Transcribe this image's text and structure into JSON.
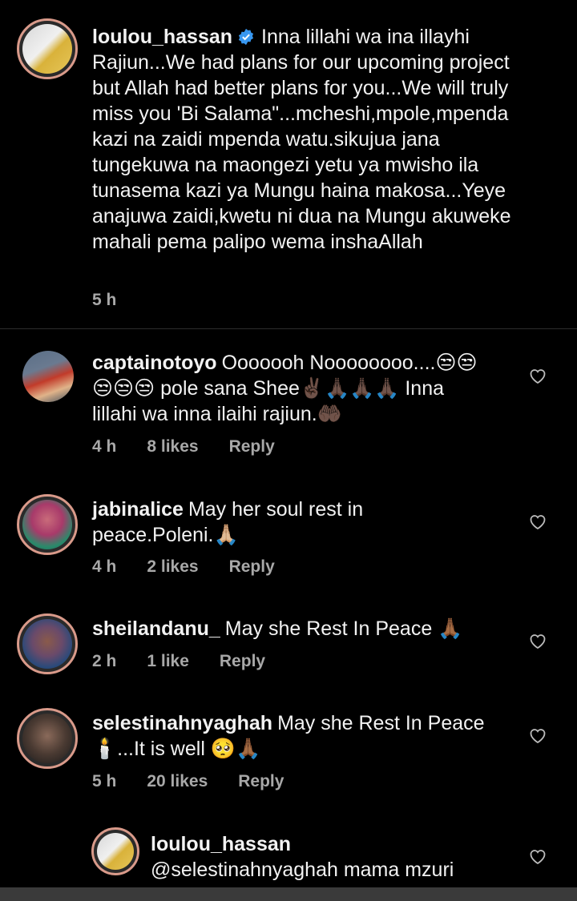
{
  "caption": {
    "username": "loulou_hassan",
    "text": "Inna lillahi wa ina illayhi Rajiun...We had plans for our upcoming project but Allah had better plans for you...We will truly miss you 'Bi Salama\"...mcheshi,mpole,mpenda kazi na zaidi mpenda watu.sikujua jana tungekuwa na maongezi yetu ya mwisho ila tunasema kazi ya Mungu haina makosa...Yeye anajuwa zaidi,kwetu ni dua na Mungu akuweke mahali pema palipo wema inshaAllah",
    "time": "5 h"
  },
  "comments": [
    {
      "username": "captainotoyo",
      "text": "Ooooooh Noooooooo....😒😒😒😒😒 pole sana Shee✌🏿🙏🏿🙏🏿🙏🏿 Inna lillahi wa inna ilaihi rajiun.🤲🏿",
      "time": "4 h",
      "likes": "8 likes",
      "reply": "Reply"
    },
    {
      "username": "jabinalice",
      "text": "May her soul rest in peace.Poleni.🙏🏼",
      "time": "4 h",
      "likes": "2 likes",
      "reply": "Reply"
    },
    {
      "username": "sheilandanu_",
      "text": "May she Rest In Peace 🙏🏾",
      "time": "2 h",
      "likes": "1 like",
      "reply": "Reply"
    },
    {
      "username": "selestinahnyaghah",
      "text": "May she Rest In Peace 🕯️...It is well 🥺🙏🏾",
      "time": "5 h",
      "likes": "20 likes",
      "reply": "Reply"
    }
  ],
  "reply": {
    "username": "loulou_hassan",
    "text": "@selestinahnyaghah mama mzuri"
  },
  "icons": {
    "verified": "verified-badge-icon",
    "like": "heart-outline-icon"
  },
  "colors": {
    "background": "#000000",
    "verified": "#3897f0",
    "meta": "#a8a8a8"
  }
}
